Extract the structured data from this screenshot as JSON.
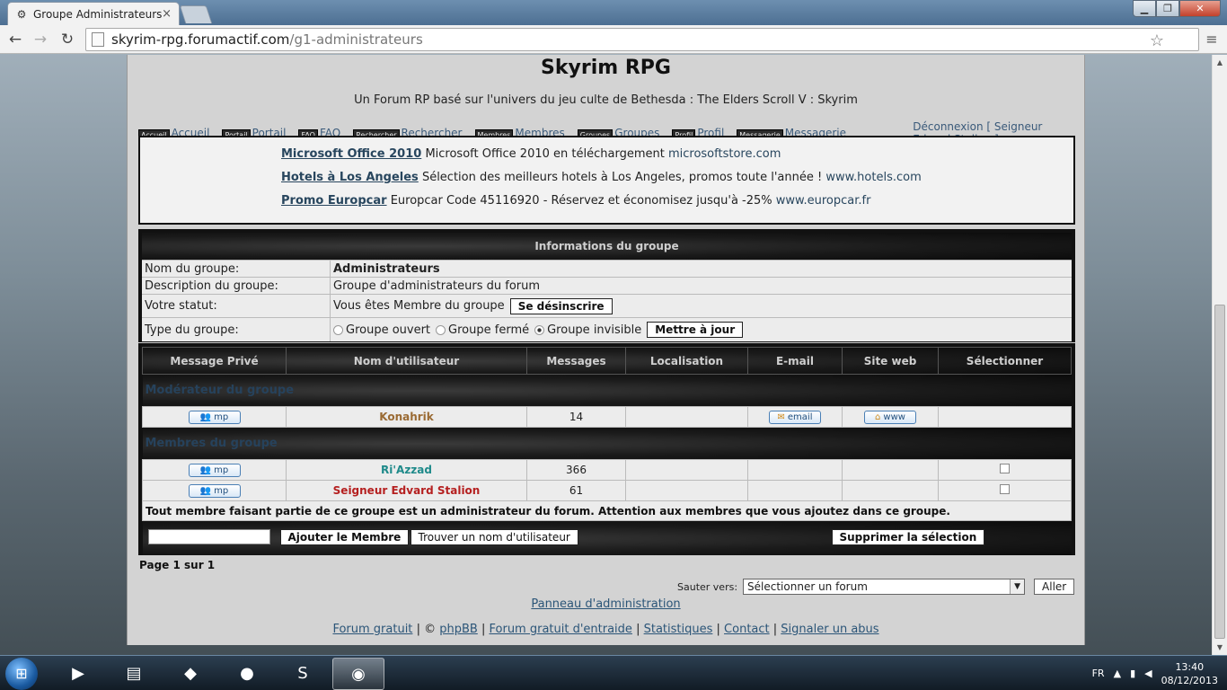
{
  "browser": {
    "tab_title": "Groupe Administrateurs",
    "tab_close": "×",
    "url_host": "skyrim-rpg.forumactif.com",
    "url_path": "/g1-administrateurs"
  },
  "site": {
    "title": "Skyrim RPG",
    "description": "Un Forum RP basé sur l'univers du jeu culte de Bethesda : The Elders Scroll V : Skyrim"
  },
  "nav": [
    {
      "icon": "Accueil",
      "label": "Accueil"
    },
    {
      "icon": "Portail",
      "label": "Portail"
    },
    {
      "icon": "FAQ",
      "label": "FAQ"
    },
    {
      "icon": "Rechercher",
      "label": "Rechercher"
    },
    {
      "icon": "Membres",
      "label": "Membres"
    },
    {
      "icon": "Groupes",
      "label": "Groupes"
    },
    {
      "icon": "Profil",
      "label": "Profil"
    },
    {
      "icon": "Messagerie",
      "label": "Messagerie"
    },
    {
      "icon": "Déconnexion",
      "label": "Déconnexion [ Seigneur Edvard Stalion ]"
    }
  ],
  "ads": [
    {
      "title": "Microsoft Office 2010",
      "text": "Microsoft Office 2010 en téléchargement",
      "url": "microsoftstore.com"
    },
    {
      "title": "Hotels à Los Angeles",
      "text": "Sélection des meilleurs hotels à Los Angeles, promos toute l'année !",
      "url": "www.hotels.com"
    },
    {
      "title": "Promo Europcar",
      "text": "Europcar Code 45116920 - Réservez et économisez jusqu'à -25%",
      "url": "www.europcar.fr"
    }
  ],
  "group": {
    "header": "Informations du groupe",
    "name_label": "Nom du groupe:",
    "name_value": "Administrateurs",
    "desc_label": "Description du groupe:",
    "desc_value": "Groupe d'administrateurs du forum",
    "status_label": "Votre statut:",
    "status_value": "Vous êtes Membre du groupe",
    "unsubscribe_btn": "Se désinscrire",
    "type_label": "Type du groupe:",
    "type_open": "Groupe ouvert",
    "type_closed": "Groupe fermé",
    "type_invisible": "Groupe invisible",
    "update_btn": "Mettre à jour"
  },
  "members": {
    "columns": [
      "Message Privé",
      "Nom d'utilisateur",
      "Messages",
      "Localisation",
      "E-mail",
      "Site web",
      "Sélectionner"
    ],
    "moderator_section": "Modérateur du groupe",
    "members_section": "Membres du groupe",
    "pm_label": "mp",
    "email_label": "email",
    "www_label": "www",
    "moderator": {
      "name": "Konahrik",
      "posts": "14"
    },
    "rows": [
      {
        "name": "Ri'Azzad",
        "posts": "366"
      },
      {
        "name": "Seigneur Edvard Stalion",
        "posts": "61"
      }
    ],
    "note": "Tout membre faisant partie de ce groupe est un administrateur du forum. Attention aux membres que vous ajoutez dans ce groupe.",
    "add_btn": "Ajouter le Membre",
    "find_btn": "Trouver un nom d'utilisateur",
    "delete_btn": "Supprimer la sélection"
  },
  "pagination": "Page 1 sur 1",
  "jump": {
    "label": "Sauter vers:",
    "selected": "Sélectionner un forum",
    "go_btn": "Aller"
  },
  "admin_link": "Panneau d'administration",
  "footer": {
    "l1": "Forum gratuit",
    "sep": "|",
    "copy": "©",
    "l2": "phpBB",
    "l3": "Forum gratuit d'entraide",
    "l4": "Statistiques",
    "l5": "Contact",
    "l6": "Signaler un abus"
  },
  "taskbar": {
    "lang": "FR",
    "time": "13:40",
    "date": "08/12/2013"
  }
}
